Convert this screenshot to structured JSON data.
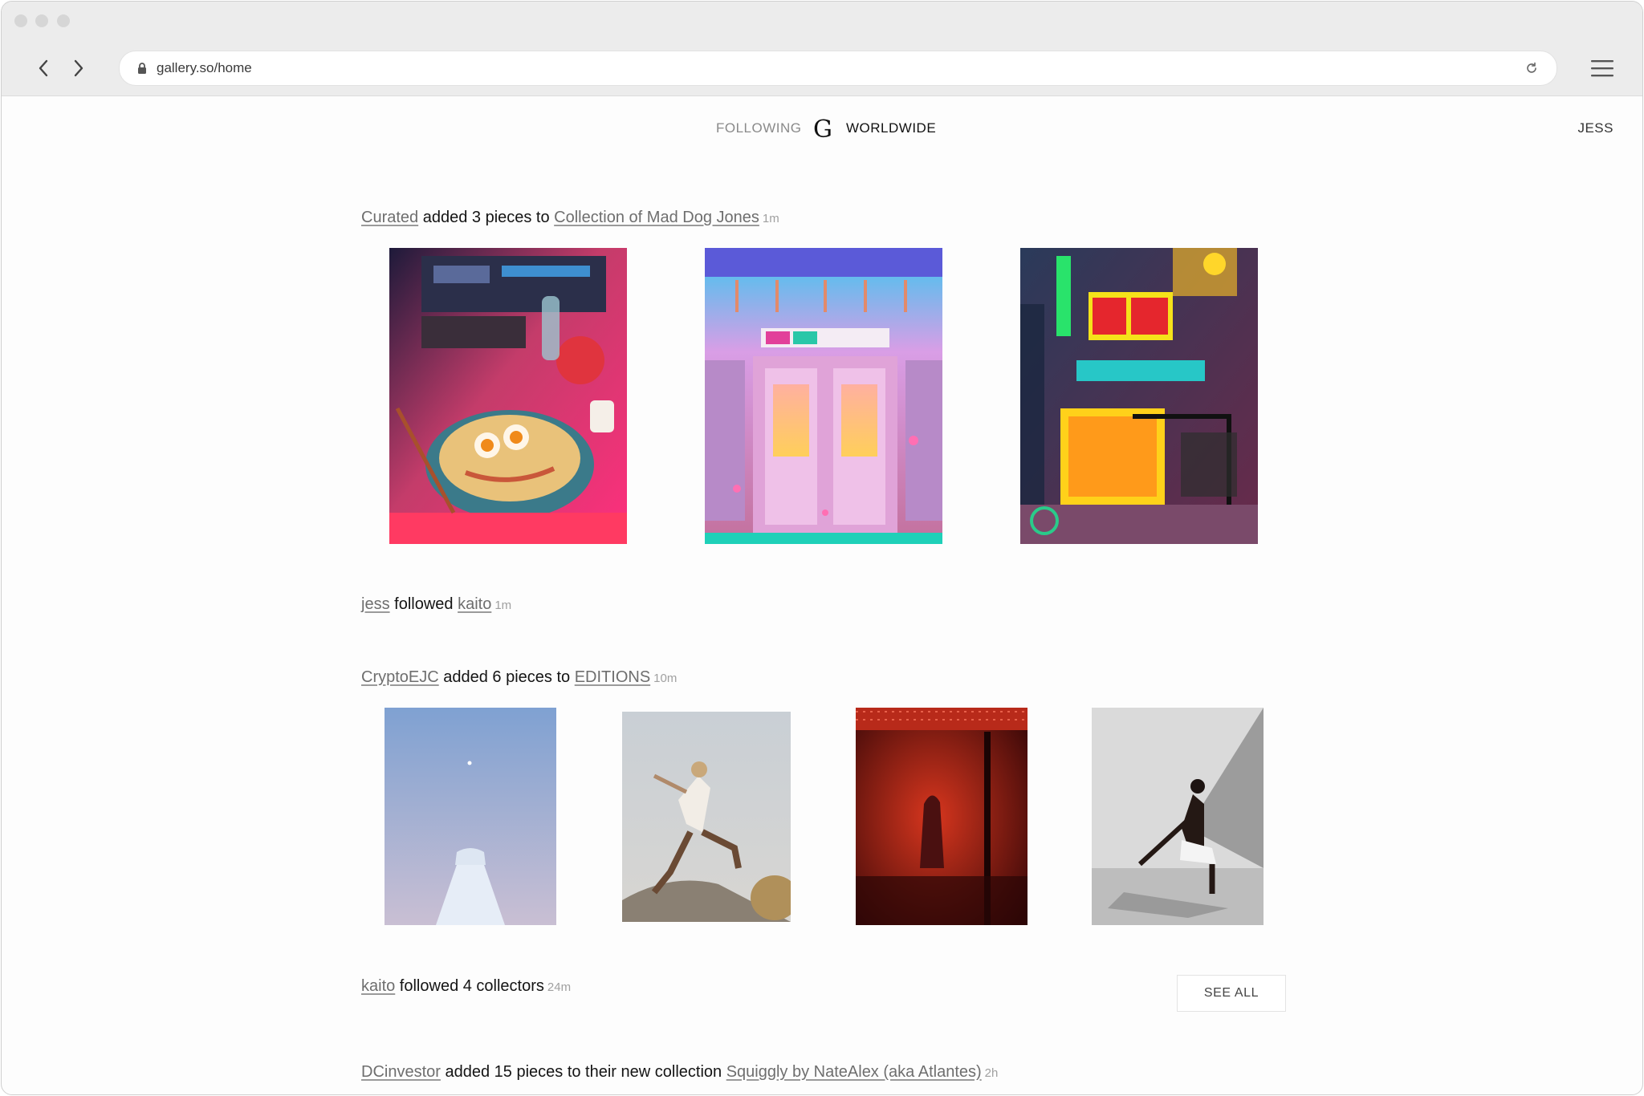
{
  "browser": {
    "url": "gallery.so/home"
  },
  "nav": {
    "following": "FOLLOWING",
    "logo": "G",
    "worldwide": "WORLDWIDE",
    "user": "JESS"
  },
  "feed": [
    {
      "actor": "Curated",
      "verb": " added 3 pieces to ",
      "target": "Collection of Mad Dog Jones",
      "time": "1m"
    },
    {
      "actor": "jess",
      "verb": " followed ",
      "target": "kaito",
      "time": "1m"
    },
    {
      "actor": "CryptoEJC",
      "verb": " added 6 pieces to ",
      "target": "EDITIONS",
      "time": "10m"
    },
    {
      "actor": "kaito",
      "verb": " followed 4 collectors",
      "time": "24m",
      "button": "SEE ALL"
    },
    {
      "actor": "DCinvestor",
      "verb": " added 15 pieces to their new collection ",
      "target": "Squiggly by NateAlex (aka Atlantes)",
      "time": "2h"
    }
  ],
  "artworks": {
    "group1": [
      "ramen-still-life-artwork",
      "pink-subway-car-artwork",
      "neon-street-sign-artwork"
    ],
    "group2": [
      "floating-dress-photo",
      "jumping-figure-photo",
      "red-silhouette-photo",
      "crouching-figure-photo"
    ]
  }
}
